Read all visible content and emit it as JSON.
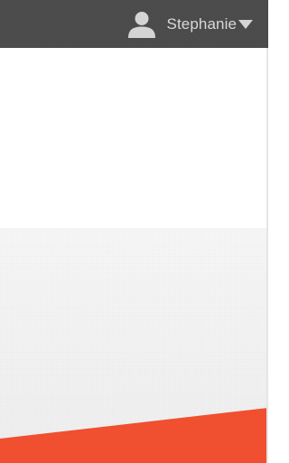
{
  "header": {
    "user": {
      "name": "Stephanie",
      "avatar_icon": "user-icon",
      "dropdown_icon": "caret-down-icon"
    }
  },
  "colors": {
    "topbar": "#4a4a4a",
    "user_text": "#d8d8d8",
    "accent_orange": "#f04f30",
    "band": "#f4f4f4"
  }
}
